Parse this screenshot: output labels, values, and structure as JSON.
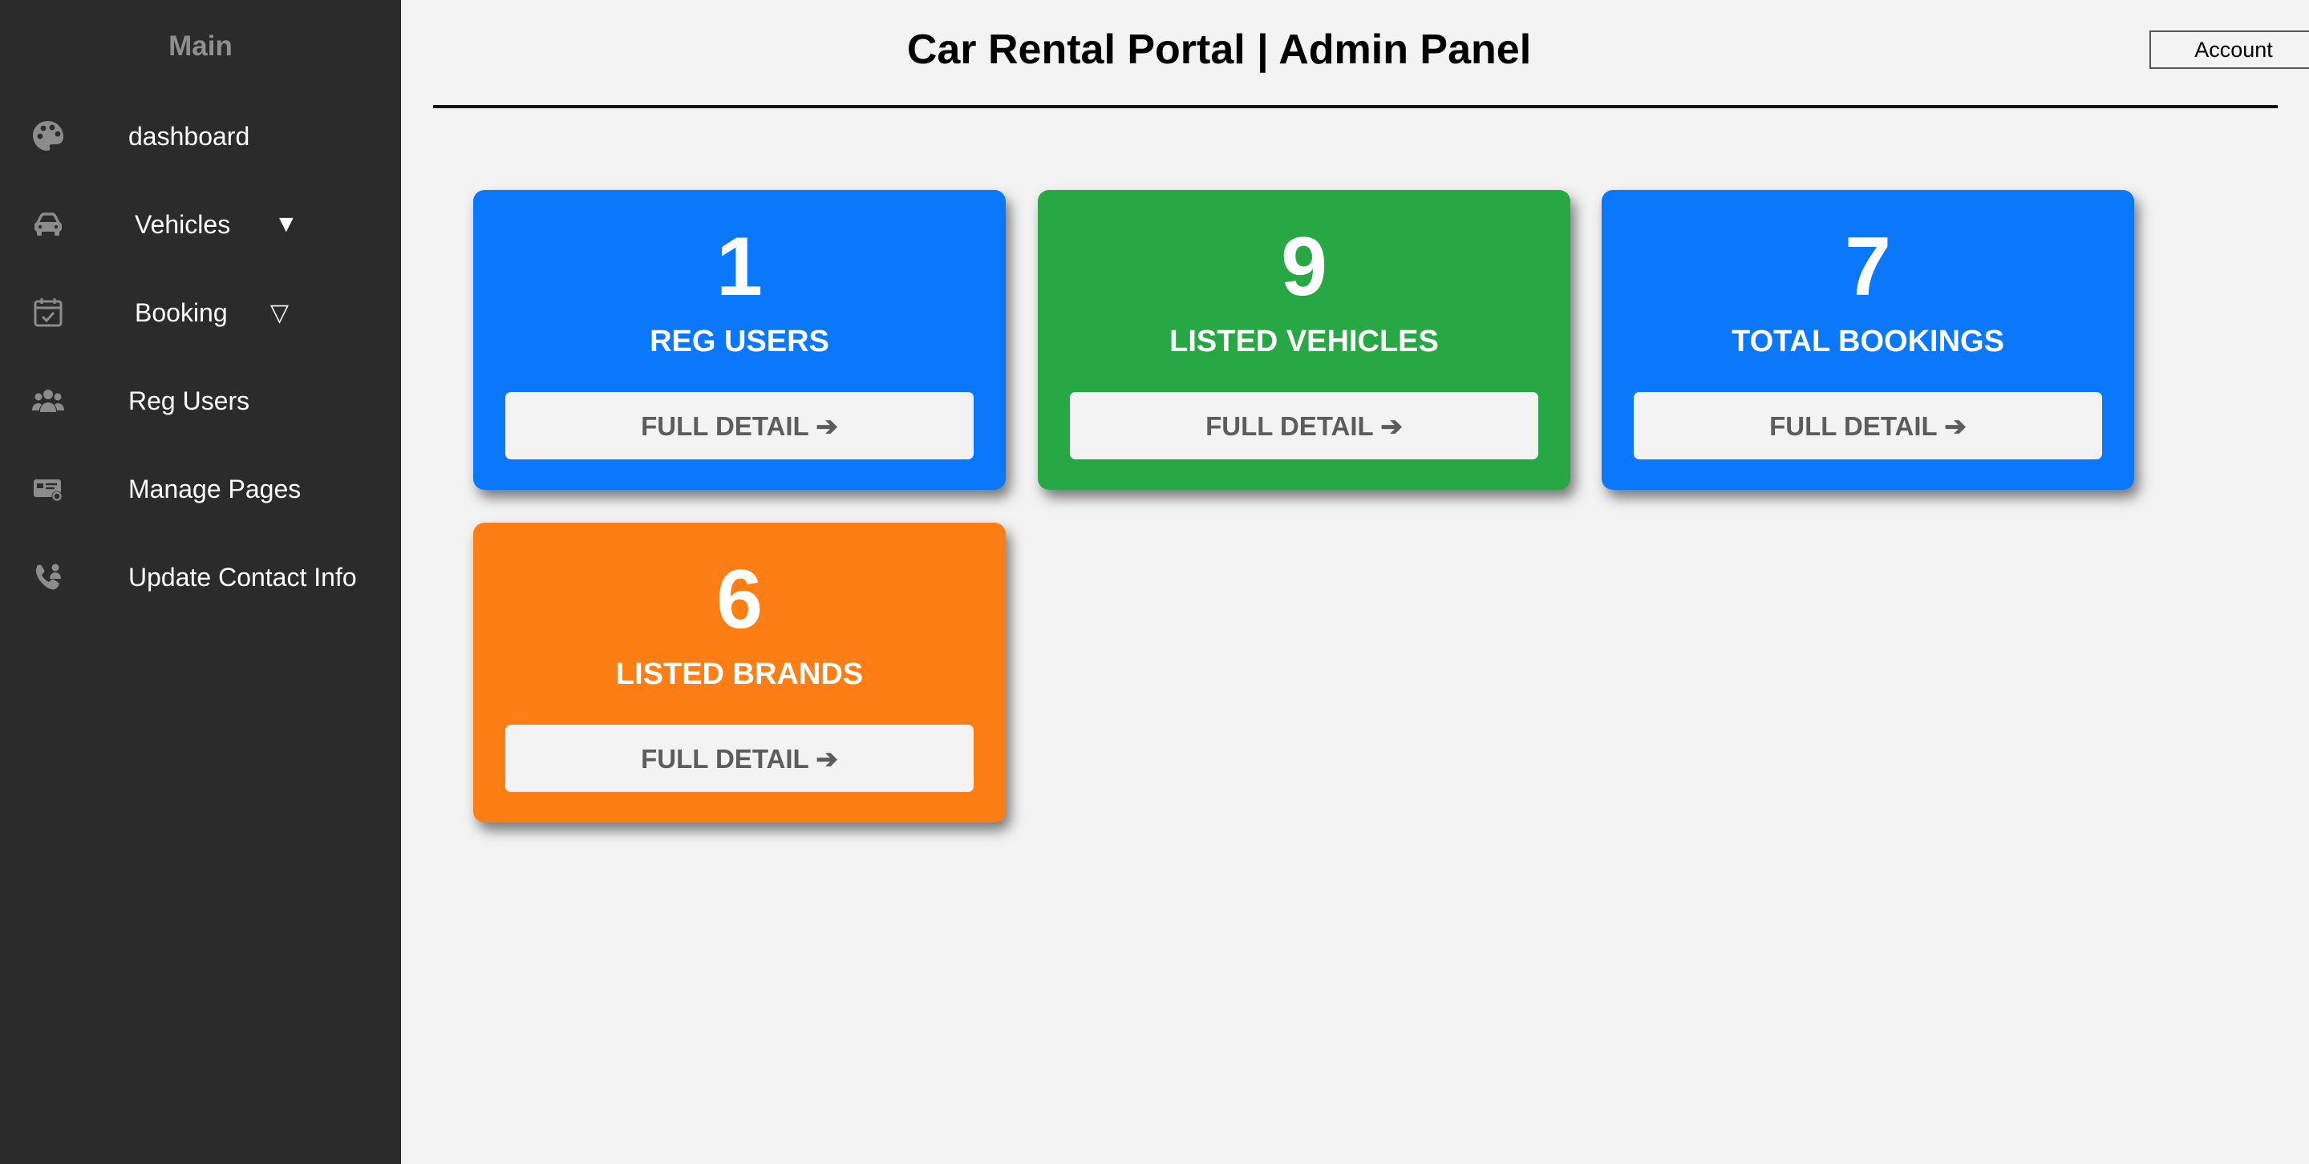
{
  "sidebar": {
    "title": "Main",
    "items": [
      {
        "label": "dashboard",
        "icon": "palette-icon"
      },
      {
        "label": "Vehicles",
        "icon": "car-icon",
        "arrow": "▼"
      },
      {
        "label": "Booking",
        "icon": "calendar-check-icon",
        "arrow": "▽"
      },
      {
        "label": "Reg Users",
        "icon": "users-icon"
      },
      {
        "label": "Manage Pages",
        "icon": "id-card-gear-icon"
      },
      {
        "label": "Update Contact Info",
        "icon": "phone-user-icon"
      }
    ]
  },
  "header": {
    "title": "Car Rental Portal | Admin Panel",
    "account_label": "Account"
  },
  "cards": [
    {
      "number": "1",
      "label": "REG USERS",
      "button": "FULL DETAIL ➔",
      "color": "#0b78fc"
    },
    {
      "number": "9",
      "label": "LISTED VEHICLES",
      "button": "FULL DETAIL ➔",
      "color": "#28a745"
    },
    {
      "number": "7",
      "label": "TOTAL BOOKINGS",
      "button": "FULL DETAIL ➔",
      "color": "#0b78fc"
    },
    {
      "number": "6",
      "label": "LISTED BRANDS",
      "button": "FULL DETAIL ➔",
      "color": "#fd7e14"
    }
  ],
  "colors": {
    "sidebar_bg": "#2b2b2b",
    "page_bg": "#f3f3f3",
    "blue": "#0b78fc",
    "green": "#28a745",
    "orange": "#fd7e14"
  }
}
